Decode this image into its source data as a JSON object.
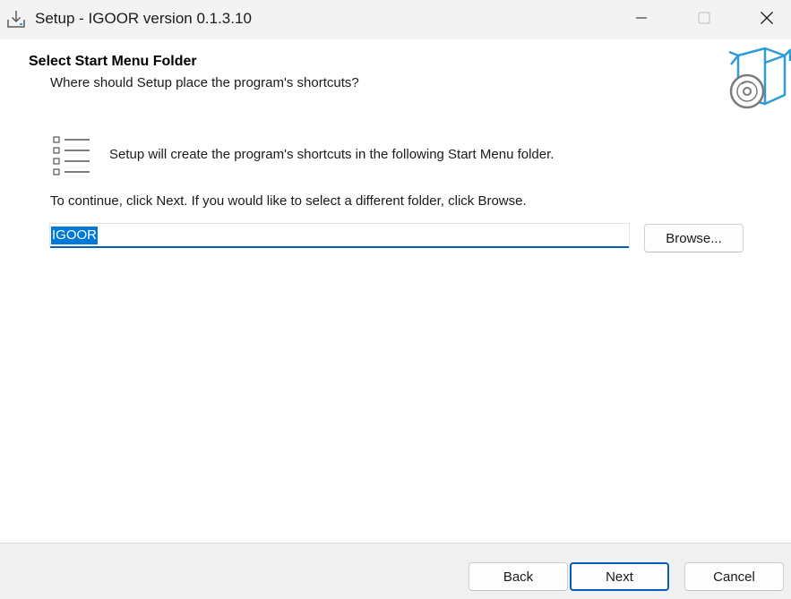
{
  "window": {
    "title": "Setup - IGOOR version 0.1.3.10",
    "icon": "installer-download-icon",
    "controls": {
      "minimize_icon": "minimize-icon",
      "maximize_icon": "maximize-icon",
      "close_icon": "close-icon"
    }
  },
  "header": {
    "title": "Select Start Menu Folder",
    "subtitle": "Where should Setup place the program's shortcuts?",
    "icon": "software-box-disc-icon"
  },
  "content": {
    "icon": "list-icon",
    "info": "Setup will create the program's shortcuts in the following Start Menu folder.",
    "instruction": "To continue, click Next. If you would like to select a different folder, click Browse.",
    "folder_value": "IGOOR",
    "browse_label": "Browse..."
  },
  "footer": {
    "back_label": "Back",
    "next_label": "Next",
    "cancel_label": "Cancel"
  },
  "colors": {
    "accent": "#005fb8",
    "selection": "#0078d7",
    "titlebar_bg": "#f3f3f3",
    "footer_bg": "#f0f0f0",
    "box_icon_blue": "#2d9bd8",
    "disc_gray": "#7a7a7a"
  }
}
